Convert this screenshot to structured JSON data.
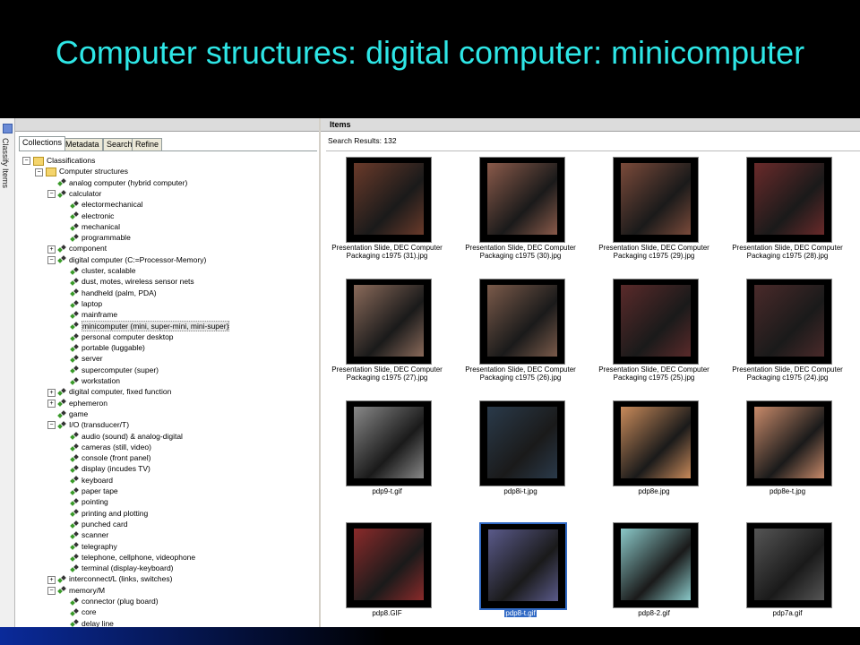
{
  "slide": {
    "title": "Computer structures: digital computer: minicomputer"
  },
  "side_strip": {
    "label": "Classify Items"
  },
  "left_panel": {
    "tabs": [
      {
        "label": "Collections",
        "active": true
      },
      {
        "label": "Metadata",
        "active": false
      },
      {
        "label": "Search",
        "active": false
      },
      {
        "label": "Refine",
        "active": false
      }
    ],
    "tree": [
      {
        "label": "Classifications",
        "indent": 0,
        "icon": "folder",
        "exp": "−",
        "sel": false
      },
      {
        "label": "Computer structures",
        "indent": 1,
        "icon": "folder",
        "exp": "−",
        "sel": false
      },
      {
        "label": "analog computer (hybrid computer)",
        "indent": 2,
        "icon": "tag",
        "exp": "",
        "sel": false
      },
      {
        "label": "calculator",
        "indent": 2,
        "icon": "tag",
        "exp": "−",
        "sel": false
      },
      {
        "label": "electormechanical",
        "indent": 3,
        "icon": "tag",
        "exp": "",
        "sel": false
      },
      {
        "label": "electronic",
        "indent": 3,
        "icon": "tag",
        "exp": "",
        "sel": false
      },
      {
        "label": "mechanical",
        "indent": 3,
        "icon": "tag",
        "exp": "",
        "sel": false
      },
      {
        "label": "programmable",
        "indent": 3,
        "icon": "tag",
        "exp": "",
        "sel": false
      },
      {
        "label": "component",
        "indent": 2,
        "icon": "tag",
        "exp": "+",
        "sel": false
      },
      {
        "label": "digital computer (C:=Processor-Memory)",
        "indent": 2,
        "icon": "tag",
        "exp": "−",
        "sel": false
      },
      {
        "label": "cluster, scalable",
        "indent": 3,
        "icon": "tag",
        "exp": "",
        "sel": false
      },
      {
        "label": "dust, motes, wireless sensor nets",
        "indent": 3,
        "icon": "tag",
        "exp": "",
        "sel": false
      },
      {
        "label": "handheld (palm, PDA)",
        "indent": 3,
        "icon": "tag",
        "exp": "",
        "sel": false
      },
      {
        "label": "laptop",
        "indent": 3,
        "icon": "tag",
        "exp": "",
        "sel": false
      },
      {
        "label": "mainframe",
        "indent": 3,
        "icon": "tag",
        "exp": "",
        "sel": false
      },
      {
        "label": "minicomputer (mini, super-mini, mini-super)",
        "indent": 3,
        "icon": "tag",
        "exp": "",
        "sel": true
      },
      {
        "label": "personal computer desktop",
        "indent": 3,
        "icon": "tag",
        "exp": "",
        "sel": false
      },
      {
        "label": "portable (luggable)",
        "indent": 3,
        "icon": "tag",
        "exp": "",
        "sel": false
      },
      {
        "label": "server",
        "indent": 3,
        "icon": "tag",
        "exp": "",
        "sel": false
      },
      {
        "label": "supercomputer (super)",
        "indent": 3,
        "icon": "tag",
        "exp": "",
        "sel": false
      },
      {
        "label": "workstation",
        "indent": 3,
        "icon": "tag",
        "exp": "",
        "sel": false
      },
      {
        "label": "digital computer, fixed function",
        "indent": 2,
        "icon": "tag",
        "exp": "+",
        "sel": false
      },
      {
        "label": "ephemeron",
        "indent": 2,
        "icon": "tag",
        "exp": "+",
        "sel": false
      },
      {
        "label": "game",
        "indent": 2,
        "icon": "tag",
        "exp": "",
        "sel": false
      },
      {
        "label": "I/O (transducer/T)",
        "indent": 2,
        "icon": "tag",
        "exp": "−",
        "sel": false
      },
      {
        "label": "audio (sound) & analog-digital",
        "indent": 3,
        "icon": "tag",
        "exp": "",
        "sel": false
      },
      {
        "label": "cameras (still, video)",
        "indent": 3,
        "icon": "tag",
        "exp": "",
        "sel": false
      },
      {
        "label": "console (front panel)",
        "indent": 3,
        "icon": "tag",
        "exp": "",
        "sel": false
      },
      {
        "label": "display (incudes TV)",
        "indent": 3,
        "icon": "tag",
        "exp": "",
        "sel": false
      },
      {
        "label": "keyboard",
        "indent": 3,
        "icon": "tag",
        "exp": "",
        "sel": false
      },
      {
        "label": "paper tape",
        "indent": 3,
        "icon": "tag",
        "exp": "",
        "sel": false
      },
      {
        "label": "pointing",
        "indent": 3,
        "icon": "tag",
        "exp": "",
        "sel": false
      },
      {
        "label": "printing and plotting",
        "indent": 3,
        "icon": "tag",
        "exp": "",
        "sel": false
      },
      {
        "label": "punched card",
        "indent": 3,
        "icon": "tag",
        "exp": "",
        "sel": false
      },
      {
        "label": "scanner",
        "indent": 3,
        "icon": "tag",
        "exp": "",
        "sel": false
      },
      {
        "label": "telegraphy",
        "indent": 3,
        "icon": "tag",
        "exp": "",
        "sel": false
      },
      {
        "label": "telephone, cellphone, videophone",
        "indent": 3,
        "icon": "tag",
        "exp": "",
        "sel": false
      },
      {
        "label": "terminal (display-keyboard)",
        "indent": 3,
        "icon": "tag",
        "exp": "",
        "sel": false
      },
      {
        "label": "interconnect/L (links, switches)",
        "indent": 2,
        "icon": "tag",
        "exp": "+",
        "sel": false
      },
      {
        "label": "memory/M",
        "indent": 2,
        "icon": "tag",
        "exp": "−",
        "sel": false
      },
      {
        "label": "connector (plug board)",
        "indent": 3,
        "icon": "tag",
        "exp": "",
        "sel": false
      },
      {
        "label": "core",
        "indent": 3,
        "icon": "tag",
        "exp": "",
        "sel": false
      },
      {
        "label": "delay line",
        "indent": 3,
        "icon": "tag",
        "exp": "",
        "sel": false
      }
    ]
  },
  "right_panel": {
    "header": "Items",
    "results": "Search Results: 132",
    "items": [
      {
        "caption": "Presentation Slide, DEC Computer Packaging c1975 (31).jpg",
        "tone": "#6a3a2a",
        "selected": false
      },
      {
        "caption": "Presentation Slide, DEC Computer Packaging c1975 (30).jpg",
        "tone": "#8a5a4a",
        "selected": false
      },
      {
        "caption": "Presentation Slide, DEC Computer Packaging c1975 (29).jpg",
        "tone": "#7a4a3a",
        "selected": false
      },
      {
        "caption": "Presentation Slide, DEC Computer Packaging c1975 (28).jpg",
        "tone": "#6a2a2a",
        "selected": false
      },
      {
        "caption": "Presentation Slide, DEC Computer Packaging c1975 (27).jpg",
        "tone": "#8a6a5a",
        "selected": false
      },
      {
        "caption": "Presentation Slide, DEC Computer Packaging c1975 (26).jpg",
        "tone": "#7a5a4a",
        "selected": false
      },
      {
        "caption": "Presentation Slide, DEC Computer Packaging c1975 (25).jpg",
        "tone": "#5a2a2a",
        "selected": false
      },
      {
        "caption": "Presentation Slide, DEC Computer Packaging c1975 (24).jpg",
        "tone": "#4a2a2a",
        "selected": false
      },
      {
        "caption": "pdp9-t.gif",
        "tone": "#888888",
        "selected": false
      },
      {
        "caption": "pdp8i-t.jpg",
        "tone": "#2a3a4a",
        "selected": false
      },
      {
        "caption": "pdp8e.jpg",
        "tone": "#c88a5a",
        "selected": false
      },
      {
        "caption": "pdp8e-t.jpg",
        "tone": "#c88a6a",
        "selected": false
      },
      {
        "caption": "pdp8.GIF",
        "tone": "#8a2a2a",
        "selected": false
      },
      {
        "caption": "pdp8-t.gif",
        "tone": "#5a5a8a",
        "selected": true
      },
      {
        "caption": "pdp8-2.gif",
        "tone": "#8ac8c8",
        "selected": false
      },
      {
        "caption": "pdp7a.gif",
        "tone": "#555555",
        "selected": false
      }
    ]
  }
}
